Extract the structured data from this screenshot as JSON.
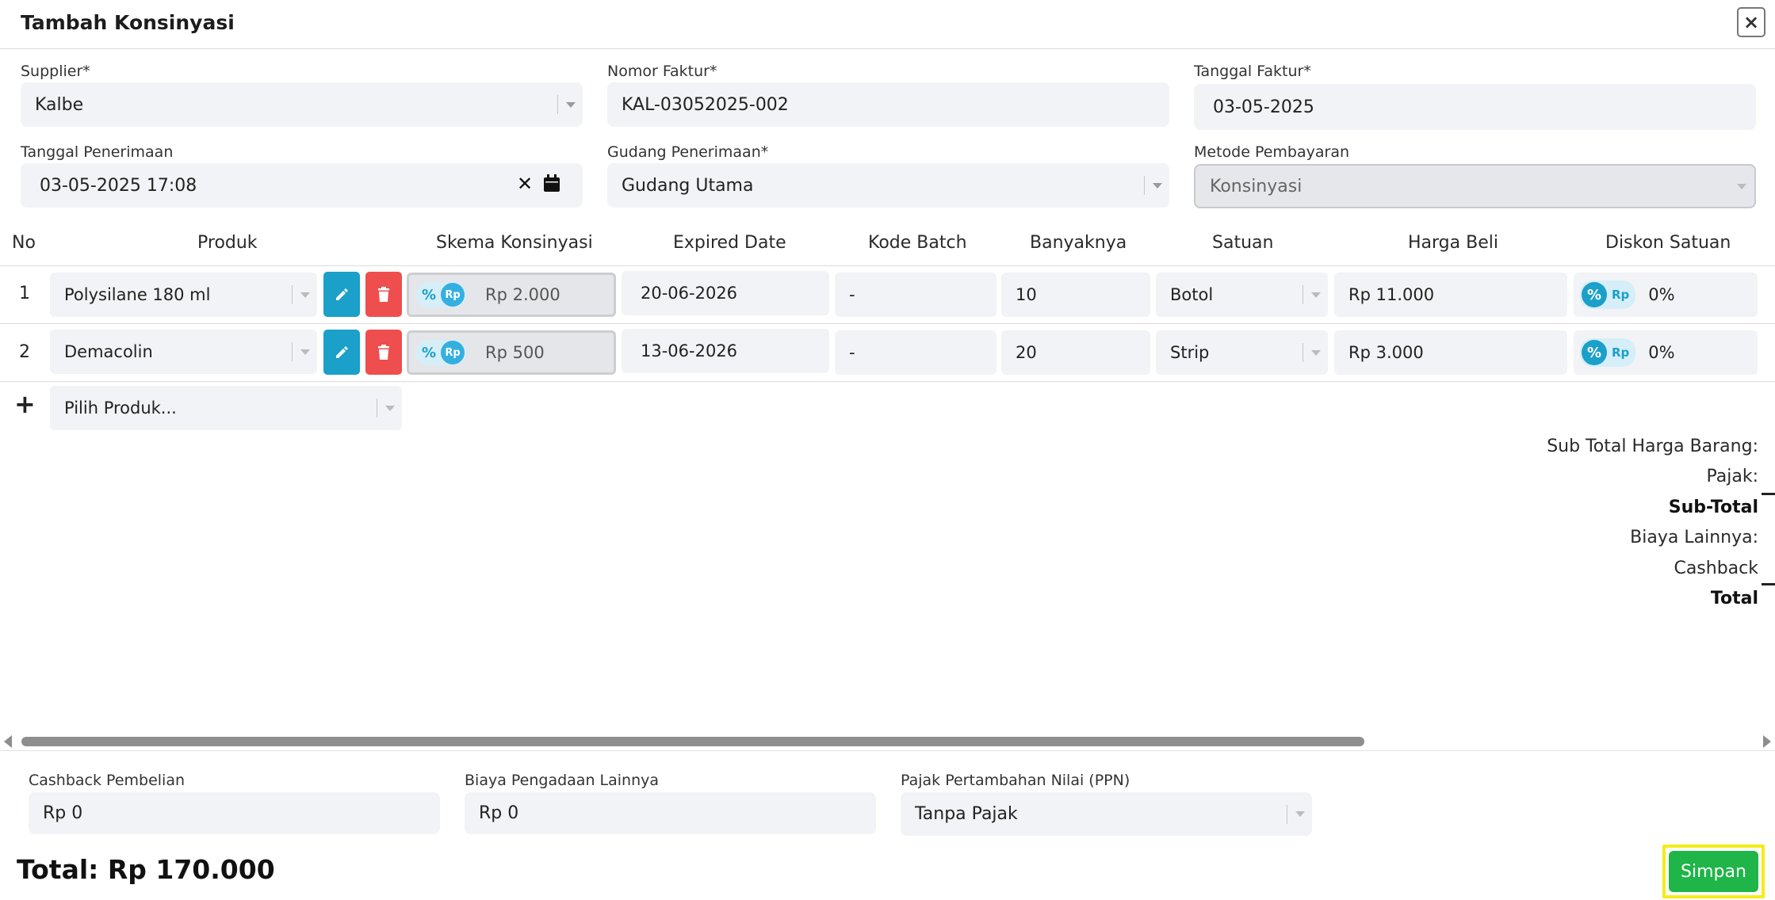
{
  "modal": {
    "title": "Tambah Konsinyasi",
    "close_label": "×"
  },
  "form": {
    "supplier": {
      "label": "Supplier*",
      "value": "Kalbe"
    },
    "nomor_faktur": {
      "label": "Nomor Faktur*",
      "value": "KAL-03052025-002"
    },
    "tanggal_faktur": {
      "label": "Tanggal Faktur*",
      "value": "03-05-2025"
    },
    "tanggal_penerimaan": {
      "label": "Tanggal Penerimaan",
      "value": "03-05-2025 17:08"
    },
    "gudang_penerimaan": {
      "label": "Gudang Penerimaan*",
      "value": "Gudang Utama"
    },
    "metode_pembayaran": {
      "label": "Metode Pembayaran",
      "value": "Konsinyasi"
    }
  },
  "table": {
    "headers": [
      "No",
      "Produk",
      "Skema Konsinyasi",
      "Expired Date",
      "Kode Batch",
      "Banyaknya",
      "Satuan",
      "Harga Beli",
      "Diskon Satuan"
    ],
    "rows": [
      {
        "no": "1",
        "produk": "Polysilane 180 ml",
        "skema": "Rp 2.000",
        "expired": "20-06-2026",
        "batch": "-",
        "qty": "10",
        "satuan": "Botol",
        "harga": "Rp 11.000",
        "diskon": "0%"
      },
      {
        "no": "2",
        "produk": "Demacolin",
        "skema": "Rp 500",
        "expired": "13-06-2026",
        "batch": "-",
        "qty": "20",
        "satuan": "Strip",
        "harga": "Rp 3.000",
        "diskon": "0%"
      }
    ],
    "toggle_pct": "%",
    "toggle_rp": "Rp",
    "add_placeholder": "Pilih Produk...",
    "add_icon": "+"
  },
  "summary": {
    "sub_total_harga": "Sub Total Harga Barang:",
    "pajak": "Pajak:",
    "sub_total": "Sub-Total",
    "biaya_lainnya": "Biaya Lainnya:",
    "cashback": "Cashback",
    "total": "Total"
  },
  "footer": {
    "cashback": {
      "label": "Cashback Pembelian",
      "value": "Rp 0"
    },
    "biaya": {
      "label": "Biaya Pengadaan Lainnya",
      "value": "Rp 0"
    },
    "ppn": {
      "label": "Pajak Pertambahan Nilai (PPN)",
      "value": "Tanpa Pajak"
    },
    "total": "Total: Rp 170.000",
    "save_label": "Simpan"
  },
  "colors": {
    "edit": "#1aa0c9",
    "delete": "#ef4e4e",
    "save": "#1fb548",
    "highlight": "#f5ec16"
  }
}
